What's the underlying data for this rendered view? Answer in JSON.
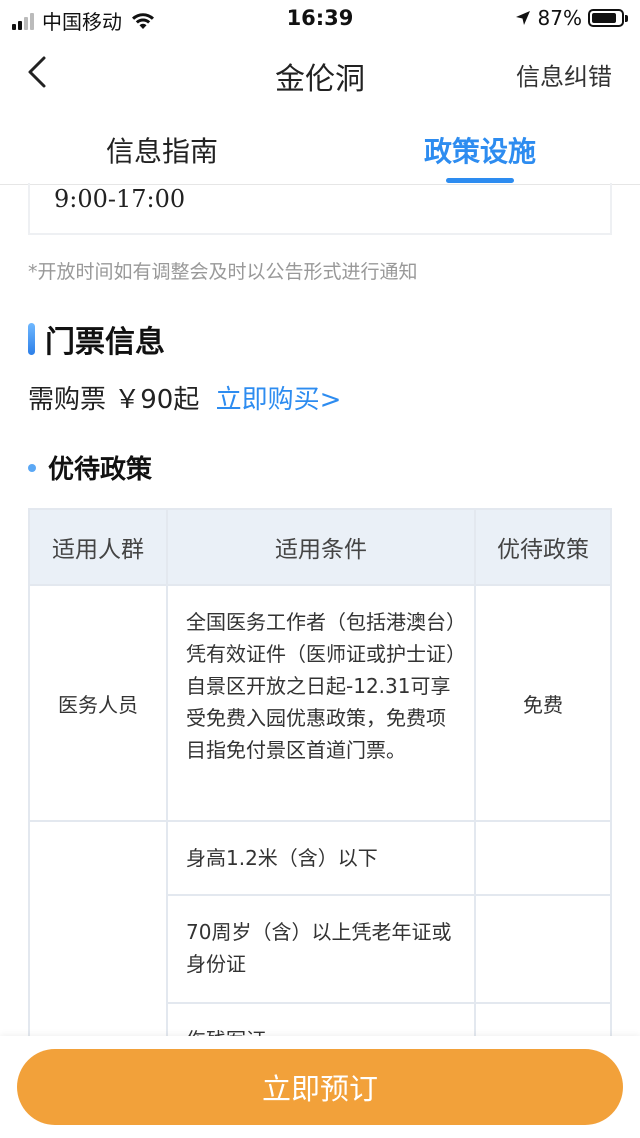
{
  "status_bar": {
    "carrier": "中国移动",
    "time": "16:39",
    "battery_pct": "87%",
    "battery_level": 0.87,
    "signal_bars": 2
  },
  "nav": {
    "back_icon": "chevron-left-icon",
    "title": "金伦洞",
    "action": "信息纠错"
  },
  "tabs": [
    {
      "label": "信息指南",
      "active": false
    },
    {
      "label": "政策设施",
      "active": true
    }
  ],
  "hours": {
    "time": "9:00-17:00",
    "notice": "*开放时间如有调整会及时以公告形式进行通知"
  },
  "ticket": {
    "section_title": "门票信息",
    "price_text": "需购票 ￥90起",
    "buy_link": "立即购买>"
  },
  "discount": {
    "title": "优待政策",
    "headers": [
      "适用人群",
      "适用条件",
      "优待政策"
    ],
    "rows": [
      {
        "group": "医务人员",
        "condition": "全国医务工作者（包括港澳台）凭有效证件（医师证或护士证）自景区开放之日起-12.31可享受免费入园优惠政策，免费项目指免付景区首道门票。",
        "policy": "免费"
      }
    ],
    "sub_conditions": [
      "身高1.2米（含）以下",
      "70周岁（含）以上凭老年证或身份证",
      "伤残军证"
    ]
  },
  "bottom": {
    "book_label": "立即预订"
  },
  "colors": {
    "accent_blue": "#2d8cf0",
    "book_orange": "#f2a13a",
    "table_header_bg": "#eaf0f7"
  }
}
